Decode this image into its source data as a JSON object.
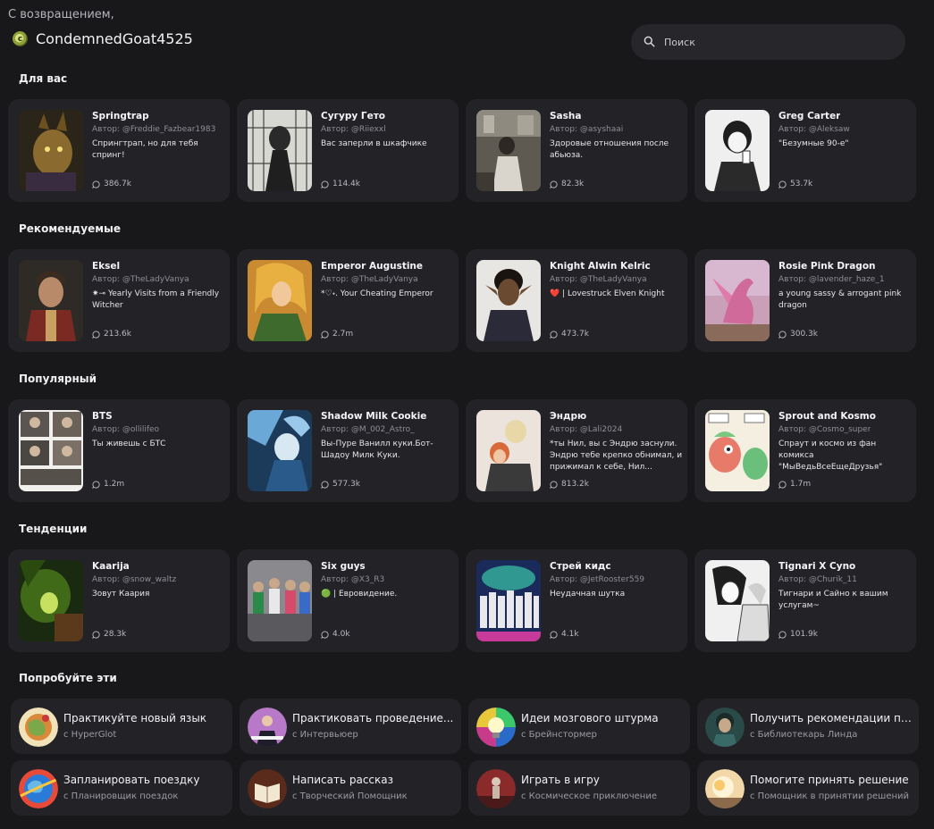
{
  "header": {
    "welcome": "С возвращением,",
    "username": "CondemnedGoat4525",
    "avatar_letter": "c"
  },
  "search": {
    "placeholder": "Поиск"
  },
  "sections": {
    "for_you": {
      "title": "Для вас",
      "cards": [
        {
          "name": "Springtrap",
          "author": "Автор: @Freddie_Fazbear1983",
          "desc": "Спрингтрап, но для тебя спринг!",
          "count": "386.7k"
        },
        {
          "name": "Сугуру Гето",
          "author": "Автор: @Riiexxl",
          "desc": "Вас заперли в шкафчике",
          "count": "114.4k"
        },
        {
          "name": "Sasha",
          "author": "Автор: @asyshaai",
          "desc": "Здоровые отношения после абьюза.",
          "count": "82.3k"
        },
        {
          "name": "Greg Carter",
          "author": "Автор: @Aleksaw",
          "desc": "\"Безумные 90-е\"",
          "count": "53.7k"
        }
      ]
    },
    "recommended": {
      "title": "Рекомендуемые",
      "cards": [
        {
          "name": "Eksel",
          "author": "Автор: @TheLadyVanya",
          "desc": "✷⊸ Yearly Visits from a Friendly Witcher",
          "count": "213.6k"
        },
        {
          "name": "Emperor Augustine",
          "author": "Автор: @TheLadyVanya",
          "desc": "*♡˖. Your Cheating Emperor",
          "count": "2.7m"
        },
        {
          "name": "Knight Alwin Kelric",
          "author": "Автор: @TheLadyVanya",
          "desc": "❤️ | Lovestruck Elven Knight",
          "count": "473.7k"
        },
        {
          "name": "Rosie Pink Dragon",
          "author": "Автор: @lavender_haze_1",
          "desc": "a young sassy & arrogant pink dragon",
          "count": "300.3k"
        }
      ]
    },
    "popular": {
      "title": "Популярный",
      "cards": [
        {
          "name": "BTS",
          "author": "Автор: @ollilifeo",
          "desc": "Ты живешь с БТС",
          "count": "1.2m"
        },
        {
          "name": "Shadow Milk Cookie",
          "author": "Автор: @M_002_Astro_",
          "desc": "Вы-Пуре Ванилл куки.Бот- Шадоу Милк Куки.",
          "count": "577.3k"
        },
        {
          "name": "Эндрю",
          "author": "Автор: @Lali2024",
          "desc": "*ты Нил, вы с Эндрю заснули. Эндрю тебе крепко обнимал, и прижимал к себе, Нил...",
          "count": "813.2k"
        },
        {
          "name": "Sprout and Kosmo",
          "author": "Автор: @Cosmo_super",
          "desc": "Спраут и космо из фан комикса \"МыВедьВсеЕщеДрузья\"",
          "count": "1.7m"
        }
      ]
    },
    "trending": {
      "title": "Тенденции",
      "cards": [
        {
          "name": "Kaarija",
          "author": "Автор: @snow_waltz",
          "desc": "Зовут Каария",
          "count": "28.3k"
        },
        {
          "name": "Six guys",
          "author": "Автор: @X3_R3",
          "desc": "🟢 | Евровидение.",
          "count": "4.0k"
        },
        {
          "name": "Стрей кидс",
          "author": "Автор: @JetRooster559",
          "desc": "Неудачная шутка",
          "count": "4.1k"
        },
        {
          "name": "Tignari X Cyno",
          "author": "Автор: @Churik_11",
          "desc": "Тигнари и Сайно к вашим услугам~",
          "count": "101.9k"
        }
      ]
    },
    "try_these": {
      "title": "Попробуйте эти",
      "items": [
        {
          "title": "Практикуйте новый язык",
          "sub": "с HyperGlot"
        },
        {
          "title": "Практиковать проведение...",
          "sub": "с Интервьюер"
        },
        {
          "title": "Идеи мозгового штурма",
          "sub": "с Брейнстормер"
        },
        {
          "title": "Получить рекомендации по...",
          "sub": "с Библиотекарь Линда"
        },
        {
          "title": "Запланировать поездку",
          "sub": "с Планировщик поездок"
        },
        {
          "title": "Написать рассказ",
          "sub": "с Творческий Помощник"
        },
        {
          "title": "Играть в игру",
          "sub": "с Космическое приключение"
        },
        {
          "title": "Помогите принять решение",
          "sub": "с Помощник в принятии решений"
        }
      ]
    }
  },
  "colors": {
    "background": "#18181b",
    "card": "#232327",
    "search_bg": "#26262b",
    "muted_text": "#8d8d96"
  },
  "icons": {
    "search": "search-icon",
    "chat_count": "chat-bubble-icon"
  }
}
